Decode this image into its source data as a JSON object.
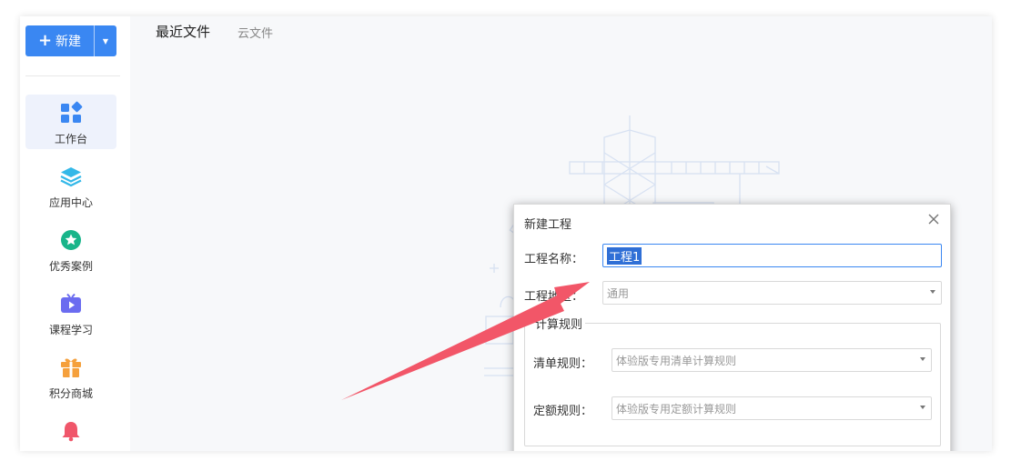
{
  "sidebar": {
    "new_button": {
      "label": "新建",
      "plus": "+",
      "dropdown_icon": "caret-down-icon"
    },
    "items": [
      {
        "label": "工作台",
        "icon": "workbench-icon",
        "active": true
      },
      {
        "label": "应用中心",
        "icon": "layers-icon"
      },
      {
        "label": "优秀案例",
        "icon": "star-badge-icon"
      },
      {
        "label": "课程学习",
        "icon": "tv-play-icon"
      },
      {
        "label": "积分商城",
        "icon": "gift-icon"
      },
      {
        "label": "",
        "icon": "bell-icon"
      }
    ]
  },
  "tabs": {
    "recent": "最近文件",
    "cloud": "云文件"
  },
  "dialog": {
    "title": "新建工程",
    "project_name_label": "工程名称：",
    "project_name_value": "工程1",
    "region_label": "工程地区：",
    "region_value": "通用",
    "rules_legend": "计算规则",
    "bill_rule_label": "清单规则：",
    "bill_rule_value": "体验版专用清单计算规则",
    "quota_rule_label": "定额规则：",
    "quota_rule_value": "体验版专用定额计算规则"
  },
  "colors": {
    "accent": "#3a87f2",
    "arrow": "#f25668",
    "workbench": "#3a87f2",
    "layers": "#33b8e8",
    "star": "#18b58a",
    "tv": "#6b6cf0",
    "gift": "#f5a03c",
    "bell": "#f0566a"
  }
}
